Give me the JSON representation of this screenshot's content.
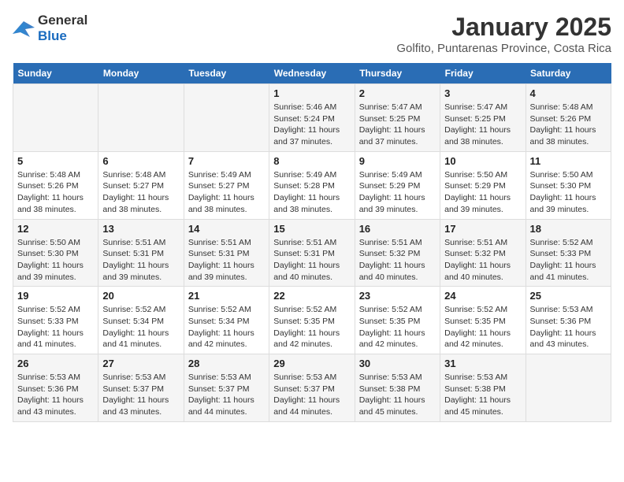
{
  "logo": {
    "general": "General",
    "blue": "Blue"
  },
  "title": "January 2025",
  "subtitle": "Golfito, Puntarenas Province, Costa Rica",
  "days_of_week": [
    "Sunday",
    "Monday",
    "Tuesday",
    "Wednesday",
    "Thursday",
    "Friday",
    "Saturday"
  ],
  "weeks": [
    [
      {
        "day": "",
        "info": ""
      },
      {
        "day": "",
        "info": ""
      },
      {
        "day": "",
        "info": ""
      },
      {
        "day": "1",
        "sunrise": "Sunrise: 5:46 AM",
        "sunset": "Sunset: 5:24 PM",
        "daylight": "Daylight: 11 hours and 37 minutes."
      },
      {
        "day": "2",
        "sunrise": "Sunrise: 5:47 AM",
        "sunset": "Sunset: 5:25 PM",
        "daylight": "Daylight: 11 hours and 37 minutes."
      },
      {
        "day": "3",
        "sunrise": "Sunrise: 5:47 AM",
        "sunset": "Sunset: 5:25 PM",
        "daylight": "Daylight: 11 hours and 38 minutes."
      },
      {
        "day": "4",
        "sunrise": "Sunrise: 5:48 AM",
        "sunset": "Sunset: 5:26 PM",
        "daylight": "Daylight: 11 hours and 38 minutes."
      }
    ],
    [
      {
        "day": "5",
        "sunrise": "Sunrise: 5:48 AM",
        "sunset": "Sunset: 5:26 PM",
        "daylight": "Daylight: 11 hours and 38 minutes."
      },
      {
        "day": "6",
        "sunrise": "Sunrise: 5:48 AM",
        "sunset": "Sunset: 5:27 PM",
        "daylight": "Daylight: 11 hours and 38 minutes."
      },
      {
        "day": "7",
        "sunrise": "Sunrise: 5:49 AM",
        "sunset": "Sunset: 5:27 PM",
        "daylight": "Daylight: 11 hours and 38 minutes."
      },
      {
        "day": "8",
        "sunrise": "Sunrise: 5:49 AM",
        "sunset": "Sunset: 5:28 PM",
        "daylight": "Daylight: 11 hours and 38 minutes."
      },
      {
        "day": "9",
        "sunrise": "Sunrise: 5:49 AM",
        "sunset": "Sunset: 5:29 PM",
        "daylight": "Daylight: 11 hours and 39 minutes."
      },
      {
        "day": "10",
        "sunrise": "Sunrise: 5:50 AM",
        "sunset": "Sunset: 5:29 PM",
        "daylight": "Daylight: 11 hours and 39 minutes."
      },
      {
        "day": "11",
        "sunrise": "Sunrise: 5:50 AM",
        "sunset": "Sunset: 5:30 PM",
        "daylight": "Daylight: 11 hours and 39 minutes."
      }
    ],
    [
      {
        "day": "12",
        "sunrise": "Sunrise: 5:50 AM",
        "sunset": "Sunset: 5:30 PM",
        "daylight": "Daylight: 11 hours and 39 minutes."
      },
      {
        "day": "13",
        "sunrise": "Sunrise: 5:51 AM",
        "sunset": "Sunset: 5:31 PM",
        "daylight": "Daylight: 11 hours and 39 minutes."
      },
      {
        "day": "14",
        "sunrise": "Sunrise: 5:51 AM",
        "sunset": "Sunset: 5:31 PM",
        "daylight": "Daylight: 11 hours and 39 minutes."
      },
      {
        "day": "15",
        "sunrise": "Sunrise: 5:51 AM",
        "sunset": "Sunset: 5:31 PM",
        "daylight": "Daylight: 11 hours and 40 minutes."
      },
      {
        "day": "16",
        "sunrise": "Sunrise: 5:51 AM",
        "sunset": "Sunset: 5:32 PM",
        "daylight": "Daylight: 11 hours and 40 minutes."
      },
      {
        "day": "17",
        "sunrise": "Sunrise: 5:51 AM",
        "sunset": "Sunset: 5:32 PM",
        "daylight": "Daylight: 11 hours and 40 minutes."
      },
      {
        "day": "18",
        "sunrise": "Sunrise: 5:52 AM",
        "sunset": "Sunset: 5:33 PM",
        "daylight": "Daylight: 11 hours and 41 minutes."
      }
    ],
    [
      {
        "day": "19",
        "sunrise": "Sunrise: 5:52 AM",
        "sunset": "Sunset: 5:33 PM",
        "daylight": "Daylight: 11 hours and 41 minutes."
      },
      {
        "day": "20",
        "sunrise": "Sunrise: 5:52 AM",
        "sunset": "Sunset: 5:34 PM",
        "daylight": "Daylight: 11 hours and 41 minutes."
      },
      {
        "day": "21",
        "sunrise": "Sunrise: 5:52 AM",
        "sunset": "Sunset: 5:34 PM",
        "daylight": "Daylight: 11 hours and 42 minutes."
      },
      {
        "day": "22",
        "sunrise": "Sunrise: 5:52 AM",
        "sunset": "Sunset: 5:35 PM",
        "daylight": "Daylight: 11 hours and 42 minutes."
      },
      {
        "day": "23",
        "sunrise": "Sunrise: 5:52 AM",
        "sunset": "Sunset: 5:35 PM",
        "daylight": "Daylight: 11 hours and 42 minutes."
      },
      {
        "day": "24",
        "sunrise": "Sunrise: 5:52 AM",
        "sunset": "Sunset: 5:35 PM",
        "daylight": "Daylight: 11 hours and 42 minutes."
      },
      {
        "day": "25",
        "sunrise": "Sunrise: 5:53 AM",
        "sunset": "Sunset: 5:36 PM",
        "daylight": "Daylight: 11 hours and 43 minutes."
      }
    ],
    [
      {
        "day": "26",
        "sunrise": "Sunrise: 5:53 AM",
        "sunset": "Sunset: 5:36 PM",
        "daylight": "Daylight: 11 hours and 43 minutes."
      },
      {
        "day": "27",
        "sunrise": "Sunrise: 5:53 AM",
        "sunset": "Sunset: 5:37 PM",
        "daylight": "Daylight: 11 hours and 43 minutes."
      },
      {
        "day": "28",
        "sunrise": "Sunrise: 5:53 AM",
        "sunset": "Sunset: 5:37 PM",
        "daylight": "Daylight: 11 hours and 44 minutes."
      },
      {
        "day": "29",
        "sunrise": "Sunrise: 5:53 AM",
        "sunset": "Sunset: 5:37 PM",
        "daylight": "Daylight: 11 hours and 44 minutes."
      },
      {
        "day": "30",
        "sunrise": "Sunrise: 5:53 AM",
        "sunset": "Sunset: 5:38 PM",
        "daylight": "Daylight: 11 hours and 45 minutes."
      },
      {
        "day": "31",
        "sunrise": "Sunrise: 5:53 AM",
        "sunset": "Sunset: 5:38 PM",
        "daylight": "Daylight: 11 hours and 45 minutes."
      },
      {
        "day": "",
        "info": ""
      }
    ]
  ]
}
